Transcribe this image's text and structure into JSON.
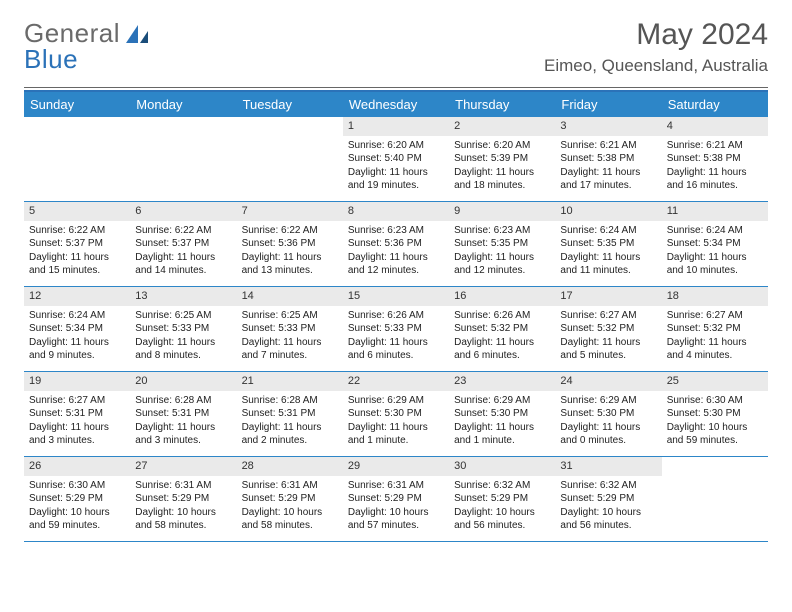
{
  "logo": {
    "part1": "General",
    "part2": "Blue"
  },
  "title": "May 2024",
  "location": "Eimeo, Queensland, Australia",
  "day_names": [
    "Sunday",
    "Monday",
    "Tuesday",
    "Wednesday",
    "Thursday",
    "Friday",
    "Saturday"
  ],
  "weeks": [
    [
      {
        "n": "",
        "sr": "",
        "ss": "",
        "dl": ""
      },
      {
        "n": "",
        "sr": "",
        "ss": "",
        "dl": ""
      },
      {
        "n": "",
        "sr": "",
        "ss": "",
        "dl": ""
      },
      {
        "n": "1",
        "sr": "Sunrise: 6:20 AM",
        "ss": "Sunset: 5:40 PM",
        "dl": "Daylight: 11 hours and 19 minutes."
      },
      {
        "n": "2",
        "sr": "Sunrise: 6:20 AM",
        "ss": "Sunset: 5:39 PM",
        "dl": "Daylight: 11 hours and 18 minutes."
      },
      {
        "n": "3",
        "sr": "Sunrise: 6:21 AM",
        "ss": "Sunset: 5:38 PM",
        "dl": "Daylight: 11 hours and 17 minutes."
      },
      {
        "n": "4",
        "sr": "Sunrise: 6:21 AM",
        "ss": "Sunset: 5:38 PM",
        "dl": "Daylight: 11 hours and 16 minutes."
      }
    ],
    [
      {
        "n": "5",
        "sr": "Sunrise: 6:22 AM",
        "ss": "Sunset: 5:37 PM",
        "dl": "Daylight: 11 hours and 15 minutes."
      },
      {
        "n": "6",
        "sr": "Sunrise: 6:22 AM",
        "ss": "Sunset: 5:37 PM",
        "dl": "Daylight: 11 hours and 14 minutes."
      },
      {
        "n": "7",
        "sr": "Sunrise: 6:22 AM",
        "ss": "Sunset: 5:36 PM",
        "dl": "Daylight: 11 hours and 13 minutes."
      },
      {
        "n": "8",
        "sr": "Sunrise: 6:23 AM",
        "ss": "Sunset: 5:36 PM",
        "dl": "Daylight: 11 hours and 12 minutes."
      },
      {
        "n": "9",
        "sr": "Sunrise: 6:23 AM",
        "ss": "Sunset: 5:35 PM",
        "dl": "Daylight: 11 hours and 12 minutes."
      },
      {
        "n": "10",
        "sr": "Sunrise: 6:24 AM",
        "ss": "Sunset: 5:35 PM",
        "dl": "Daylight: 11 hours and 11 minutes."
      },
      {
        "n": "11",
        "sr": "Sunrise: 6:24 AM",
        "ss": "Sunset: 5:34 PM",
        "dl": "Daylight: 11 hours and 10 minutes."
      }
    ],
    [
      {
        "n": "12",
        "sr": "Sunrise: 6:24 AM",
        "ss": "Sunset: 5:34 PM",
        "dl": "Daylight: 11 hours and 9 minutes."
      },
      {
        "n": "13",
        "sr": "Sunrise: 6:25 AM",
        "ss": "Sunset: 5:33 PM",
        "dl": "Daylight: 11 hours and 8 minutes."
      },
      {
        "n": "14",
        "sr": "Sunrise: 6:25 AM",
        "ss": "Sunset: 5:33 PM",
        "dl": "Daylight: 11 hours and 7 minutes."
      },
      {
        "n": "15",
        "sr": "Sunrise: 6:26 AM",
        "ss": "Sunset: 5:33 PM",
        "dl": "Daylight: 11 hours and 6 minutes."
      },
      {
        "n": "16",
        "sr": "Sunrise: 6:26 AM",
        "ss": "Sunset: 5:32 PM",
        "dl": "Daylight: 11 hours and 6 minutes."
      },
      {
        "n": "17",
        "sr": "Sunrise: 6:27 AM",
        "ss": "Sunset: 5:32 PM",
        "dl": "Daylight: 11 hours and 5 minutes."
      },
      {
        "n": "18",
        "sr": "Sunrise: 6:27 AM",
        "ss": "Sunset: 5:32 PM",
        "dl": "Daylight: 11 hours and 4 minutes."
      }
    ],
    [
      {
        "n": "19",
        "sr": "Sunrise: 6:27 AM",
        "ss": "Sunset: 5:31 PM",
        "dl": "Daylight: 11 hours and 3 minutes."
      },
      {
        "n": "20",
        "sr": "Sunrise: 6:28 AM",
        "ss": "Sunset: 5:31 PM",
        "dl": "Daylight: 11 hours and 3 minutes."
      },
      {
        "n": "21",
        "sr": "Sunrise: 6:28 AM",
        "ss": "Sunset: 5:31 PM",
        "dl": "Daylight: 11 hours and 2 minutes."
      },
      {
        "n": "22",
        "sr": "Sunrise: 6:29 AM",
        "ss": "Sunset: 5:30 PM",
        "dl": "Daylight: 11 hours and 1 minute."
      },
      {
        "n": "23",
        "sr": "Sunrise: 6:29 AM",
        "ss": "Sunset: 5:30 PM",
        "dl": "Daylight: 11 hours and 1 minute."
      },
      {
        "n": "24",
        "sr": "Sunrise: 6:29 AM",
        "ss": "Sunset: 5:30 PM",
        "dl": "Daylight: 11 hours and 0 minutes."
      },
      {
        "n": "25",
        "sr": "Sunrise: 6:30 AM",
        "ss": "Sunset: 5:30 PM",
        "dl": "Daylight: 10 hours and 59 minutes."
      }
    ],
    [
      {
        "n": "26",
        "sr": "Sunrise: 6:30 AM",
        "ss": "Sunset: 5:29 PM",
        "dl": "Daylight: 10 hours and 59 minutes."
      },
      {
        "n": "27",
        "sr": "Sunrise: 6:31 AM",
        "ss": "Sunset: 5:29 PM",
        "dl": "Daylight: 10 hours and 58 minutes."
      },
      {
        "n": "28",
        "sr": "Sunrise: 6:31 AM",
        "ss": "Sunset: 5:29 PM",
        "dl": "Daylight: 10 hours and 58 minutes."
      },
      {
        "n": "29",
        "sr": "Sunrise: 6:31 AM",
        "ss": "Sunset: 5:29 PM",
        "dl": "Daylight: 10 hours and 57 minutes."
      },
      {
        "n": "30",
        "sr": "Sunrise: 6:32 AM",
        "ss": "Sunset: 5:29 PM",
        "dl": "Daylight: 10 hours and 56 minutes."
      },
      {
        "n": "31",
        "sr": "Sunrise: 6:32 AM",
        "ss": "Sunset: 5:29 PM",
        "dl": "Daylight: 10 hours and 56 minutes."
      },
      {
        "n": "",
        "sr": "",
        "ss": "",
        "dl": ""
      }
    ]
  ]
}
